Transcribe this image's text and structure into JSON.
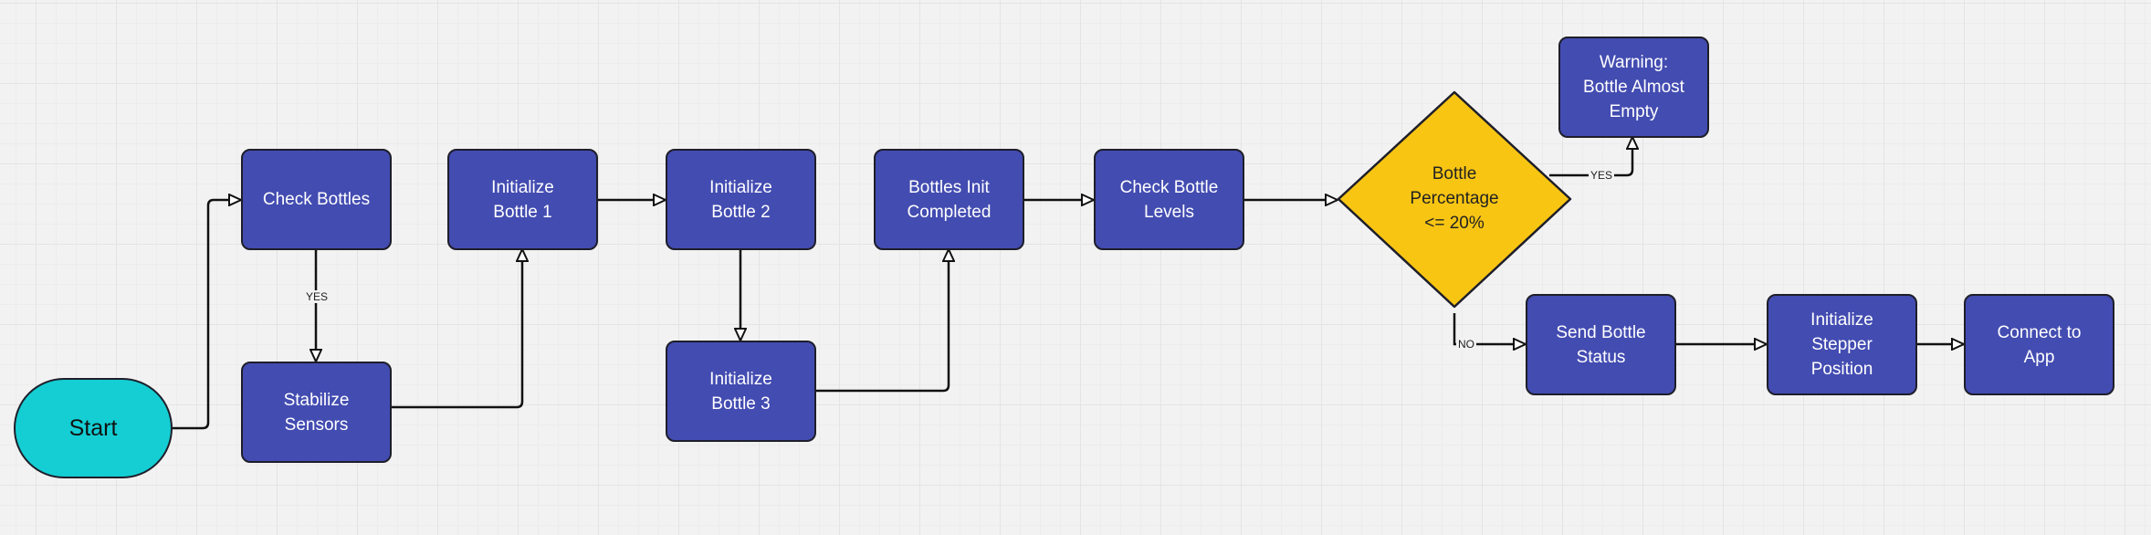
{
  "colors": {
    "process": "#434cb1",
    "start": "#14ced3",
    "decision": "#f8c513",
    "background": "#f2f2f2"
  },
  "nodes": {
    "start": "Start",
    "check_bottles": "Check Bottles",
    "stabilize_sensors": "Stabilize\nSensors",
    "init_bottle_1": "Initialize\nBottle 1",
    "init_bottle_2": "Initialize\nBottle 2",
    "init_bottle_3": "Initialize\nBottle 3",
    "bottles_init_completed": "Bottles Init\nCompleted",
    "check_bottle_levels": "Check Bottle\nLevels",
    "decision": "Bottle\nPercentage\n<= 20%",
    "warning": "Warning:\nBottle Almost\nEmpty",
    "send_bottle_status": "Send Bottle\nStatus",
    "init_stepper": "Initialize\nStepper\nPosition",
    "connect_app": "Connect to\nApp"
  },
  "edge_labels": {
    "check_yes": "YES",
    "decision_yes": "YES",
    "decision_no": "NO"
  }
}
